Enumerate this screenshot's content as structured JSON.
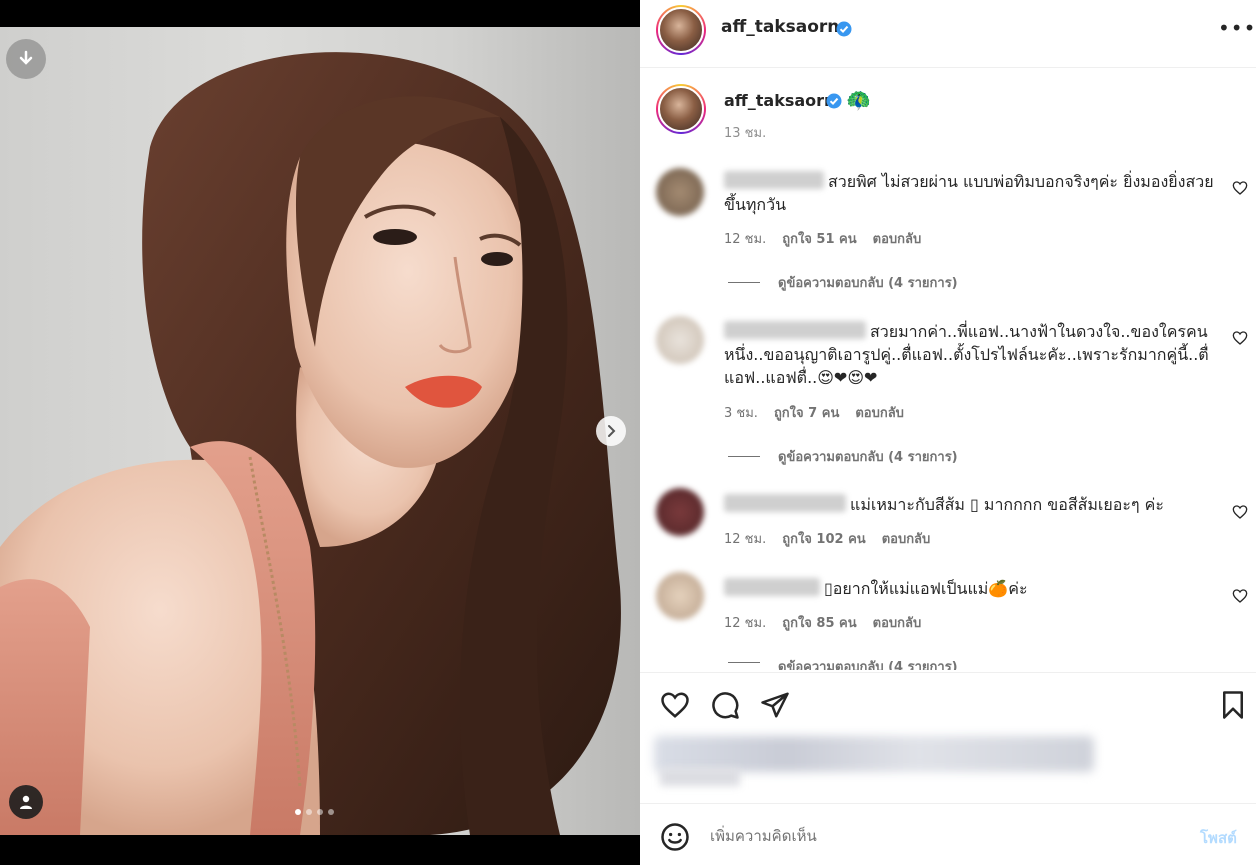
{
  "post": {
    "username": "aff_taksaorn",
    "caption_time": "13 ชม.",
    "caption_emoji": "🦚",
    "carousel_pages": 4,
    "carousel_active": 1
  },
  "comments": [
    {
      "text": "สวยพิศ ไม่สวยผ่าน แบบพ่อทิมบอกจริงๆค่ะ ยิ่งมองยิ่งสวยขึ้นทุกวัน",
      "time": "12 ชม.",
      "likes": "ถูกใจ 51 คน",
      "reply": "ตอบกลับ",
      "view_replies": "ดูข้อความตอบกลับ (4 รายการ)"
    },
    {
      "text": "สวยมากค่า..พี่แอฟ..นางฟ้าในดวงใจ..ของใครคนหนึ่ง..ขออนุญาติเอารูปคู่..ตื่แอฟ..ตั้งโปรไฟล์นะคัะ..เพราะรักมากคู่นี้..ตื่แอฟ..แอฟตื่..😍❤😍❤",
      "time": "3 ชม.",
      "likes": "ถูกใจ 7 คน",
      "reply": "ตอบกลับ",
      "view_replies": "ดูข้อความตอบกลับ (4 รายการ)"
    },
    {
      "text": "แม่เหมาะกับสีส้ม ▯ มากกกก ขอสีส้มเยอะๆ ค่ะ",
      "time": "12 ชม.",
      "likes": "ถูกใจ 102 คน",
      "reply": "ตอบกลับ"
    },
    {
      "text": "▯อยากให้แม่แอฟเป็นแม่🍊ค่ะ",
      "time": "12 ชม.",
      "likes": "ถูกใจ 85 คน",
      "reply": "ตอบกลับ",
      "view_replies": "ดูข้อความตอบกลับ (4 รายการ)"
    }
  ],
  "add_comment": {
    "placeholder": "เพิ่มความคิดเห็น",
    "post_label": "โพสต์"
  },
  "colors": {
    "verified": "#3897f0",
    "post_disabled": "#b3dbff",
    "muted_text": "#737373"
  }
}
